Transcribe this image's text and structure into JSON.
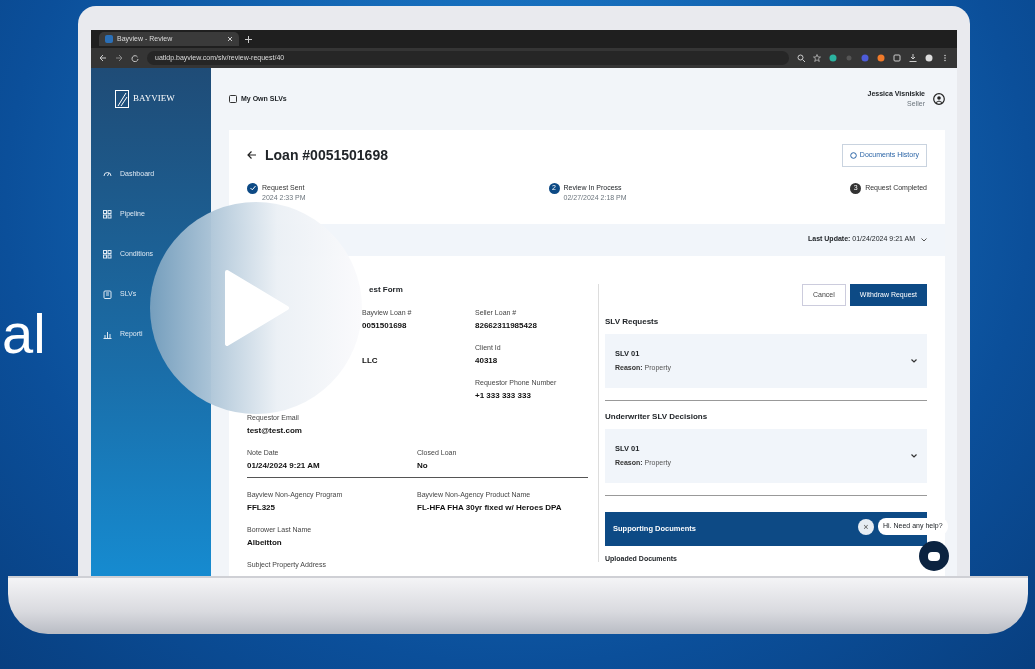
{
  "backdrop_text": "al",
  "browser": {
    "tab_title": "Bayview - Review",
    "url": "uatldp.bayview.com/slv/review-request/40"
  },
  "sidebar": {
    "logo_text": "BAYVIEW",
    "items": [
      {
        "label": "Dashboard"
      },
      {
        "label": "Pipeline"
      },
      {
        "label": "Conditions"
      },
      {
        "label": "SLVs"
      },
      {
        "label": "Reporti"
      }
    ]
  },
  "header": {
    "breadcrumb": "My Own SLVs",
    "user_name": "Jessica Visniskie",
    "user_role": "Seller"
  },
  "loan": {
    "title": "Loan #0051501698",
    "history_button": "Documents History"
  },
  "steps": [
    {
      "label": "Request Sent",
      "date": "2024 2:33 PM",
      "completed": true,
      "current": false
    },
    {
      "label": "Review In Process",
      "date": "02/27/2024 2:18 PM",
      "completed": false,
      "current": true,
      "number": "2"
    },
    {
      "label": "Request Completed",
      "completed": false,
      "current": false,
      "number": "3"
    }
  ],
  "last_update": {
    "label": "Last Update:",
    "value": "01/24/2024 9:21 AM"
  },
  "form": {
    "title": "est Form",
    "rows": [
      {
        "kind": "fields",
        "cells": [
          null,
          {
            "label": "Bayview Loan #",
            "value": "0051501698"
          },
          {
            "label": "Seller Loan #",
            "value": "82662311985428"
          }
        ]
      },
      {
        "kind": "fields",
        "cells": [
          null,
          {
            "value": "LLC"
          },
          {
            "label": "Client Id",
            "value": "40318"
          }
        ]
      },
      {
        "kind": "fields",
        "cells": [
          null,
          null,
          {
            "label": "Requestor Phone Number",
            "value": "+1 333 333 333"
          }
        ]
      },
      {
        "kind": "fields",
        "cells": [
          {
            "label": "Requestor Email",
            "value": "test@test.com"
          }
        ]
      },
      {
        "kind": "fields",
        "cells": [
          {
            "label": "Note Date",
            "value": "01/24/2024 9:21 AM"
          },
          {
            "label": "Closed Loan",
            "value": "No"
          }
        ]
      },
      {
        "kind": "divider"
      },
      {
        "kind": "fields",
        "cells": [
          {
            "label": "Bayview Non-Agency Program",
            "value": "FFL325"
          },
          {
            "label": "Bayview Non-Agency Product Name",
            "value": "FL-HFA FHA 30yr fixed w/ Heroes DPA"
          }
        ]
      },
      {
        "kind": "fields",
        "cells": [
          {
            "label": "Borrower Last Name",
            "value": "Albeitton"
          }
        ]
      },
      {
        "kind": "fields",
        "cells": [
          {
            "label": "Subject Property Address"
          }
        ]
      }
    ]
  },
  "actions": {
    "cancel": "Cancel",
    "withdraw": "Withdraw Request"
  },
  "sections": [
    {
      "title": "SLV Requests",
      "items": [
        {
          "name": "SLV 01",
          "reason_label": "Reason:",
          "reason": "Property",
          "expanded": false
        }
      ]
    },
    {
      "title": "Underwriter SLV Decisions",
      "items": [
        {
          "name": "SLV 01",
          "reason_label": "Reason:",
          "reason": "Property",
          "expanded": false
        }
      ]
    }
  ],
  "supporting": {
    "title": "Supporting Documents",
    "subtitle": "Uploaded Documents"
  },
  "chat": {
    "message": "Hi. Need any help?",
    "close": "×"
  }
}
